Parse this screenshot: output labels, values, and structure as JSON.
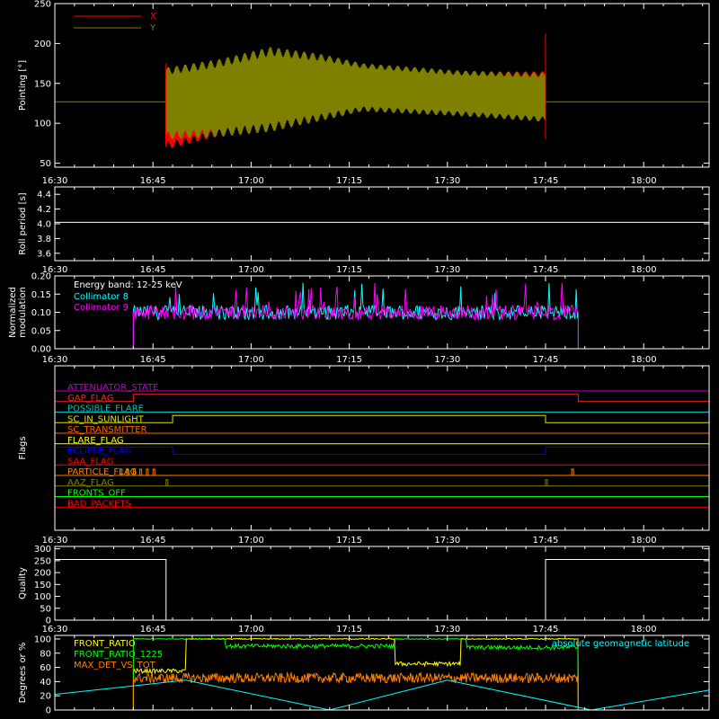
{
  "time_axis": {
    "range": [
      "16:30",
      "18:10"
    ],
    "ticks": [
      "16:30",
      "16:45",
      "17:00",
      "17:15",
      "17:30",
      "17:45",
      "18:00"
    ]
  },
  "chart_data": [
    {
      "id": "pointing",
      "type": "line",
      "title": "",
      "xlabel": "",
      "ylabel": "Pointing [°]",
      "ylim": [
        45,
        250
      ],
      "yticks": [
        50,
        100,
        150,
        200,
        250
      ],
      "legend": {
        "placement": "top-left",
        "entries": [
          {
            "name": "X",
            "color": "#ff0000"
          },
          {
            "name": "Y",
            "color": "#808000"
          }
        ]
      },
      "reference_line": {
        "y": 127,
        "color": "#808000"
      },
      "series": [
        {
          "name": "X",
          "color": "#ff0000",
          "start": "16:47",
          "end": "17:45",
          "upper": [
            [
              0,
              155
            ],
            [
              15,
              168
            ],
            [
              30,
              158
            ],
            [
              45,
              162
            ],
            [
              58,
              162
            ]
          ],
          "lower": [
            [
              0,
              72
            ],
            [
              15,
              102
            ],
            [
              30,
              122
            ],
            [
              45,
              118
            ],
            [
              58,
              110
            ]
          ]
        },
        {
          "name": "Y",
          "color": "#808000",
          "start": "16:47",
          "end": "17:45",
          "upper": [
            [
              0,
              165
            ],
            [
              8,
              175
            ],
            [
              16,
              190
            ],
            [
              24,
              182
            ],
            [
              30,
              172
            ],
            [
              45,
              163
            ],
            [
              58,
              160
            ]
          ],
          "lower": [
            [
              0,
              85
            ],
            [
              8,
              88
            ],
            [
              16,
              95
            ],
            [
              24,
              108
            ],
            [
              30,
              118
            ],
            [
              45,
              112
            ],
            [
              58,
              105
            ]
          ]
        }
      ],
      "spikes": [
        {
          "x": "16:47",
          "y": [
            70,
            175
          ]
        },
        {
          "x": "17:45",
          "y": [
            80,
            212
          ]
        }
      ]
    },
    {
      "id": "roll-period",
      "type": "line",
      "title": "",
      "ylabel": "Roll period [s]",
      "ylim": [
        3.5,
        4.5
      ],
      "yticks": [
        "3.6",
        "3.8",
        "4.0",
        "4.2",
        "4.4"
      ],
      "series": [
        {
          "name": "",
          "color": "#ffffff",
          "x": [
            "16:30",
            "18:10"
          ],
          "values": [
            4.02,
            4.02
          ]
        }
      ]
    },
    {
      "id": "modulation",
      "type": "line",
      "title": "",
      "ylabel": "Normalized modulation",
      "ylim": [
        0,
        0.2
      ],
      "yticks": [
        "0.00",
        "0.05",
        "0.10",
        "0.15",
        "0.20"
      ],
      "annotation": "Energy band: 12-25 keV",
      "legend": {
        "placement": "top-left",
        "entries": [
          {
            "name": "Collimator 8",
            "color": "#00ffff"
          },
          {
            "name": "Collimator 9",
            "color": "#ff00ff"
          }
        ]
      },
      "active_range": [
        "16:42",
        "17:50"
      ],
      "series": [
        {
          "name": "Collimator 8",
          "color": "#00ffff",
          "baseline": 0.1
        },
        {
          "name": "Collimator 9",
          "color": "#ff00ff",
          "baseline": 0.1
        }
      ]
    },
    {
      "id": "flags",
      "type": "line",
      "title": "",
      "ylabel": "Flags",
      "flags": [
        {
          "name": "ATTENUATOR_STATE",
          "color": "#c000c0",
          "steps": []
        },
        {
          "name": "GAP_FLAG",
          "color": "#ff2020",
          "steps": [
            [
              "16:30",
              0
            ],
            [
              "16:42",
              1
            ],
            [
              "17:50",
              0
            ]
          ]
        },
        {
          "name": "POSSIBLE_FLARE",
          "color": "#00c0c0",
          "steps": []
        },
        {
          "name": "SC_IN_SUNLIGHT",
          "color": "#e0e000",
          "steps": [
            [
              "16:30",
              0
            ],
            [
              "16:48",
              1
            ],
            [
              "17:45",
              0
            ]
          ]
        },
        {
          "name": "SC_TRANSMITTER",
          "color": "#ff6000",
          "steps": []
        },
        {
          "name": "FLARE_FLAG",
          "color": "#ffff00",
          "steps": []
        },
        {
          "name": "ECLIPSE_FLAG",
          "color": "#0000ff",
          "steps": [
            [
              "16:30",
              1
            ],
            [
              "16:48",
              0
            ],
            [
              "17:45",
              1
            ]
          ]
        },
        {
          "name": "SAA_FLAG",
          "color": "#ff0000",
          "steps": []
        },
        {
          "name": "PARTICLE_FLAG",
          "color": "#ff7f00",
          "pulses": [
            "16:40",
            "16:41",
            "16:42",
            "16:43",
            "16:44",
            "16:45",
            "17:49"
          ]
        },
        {
          "name": "AAZ_FLAG",
          "color": "#808000",
          "pulses": [
            "16:47",
            "17:45"
          ]
        },
        {
          "name": "FRONTS_OFF",
          "color": "#00ff00",
          "steps": []
        },
        {
          "name": "BAD_PACKETS",
          "color": "#ff0000",
          "steps": []
        }
      ]
    },
    {
      "id": "quality",
      "type": "line",
      "title": "",
      "ylabel": "Quality",
      "ylim": [
        0,
        310
      ],
      "yticks": [
        0,
        50,
        100,
        150,
        200,
        250,
        300
      ],
      "series": [
        {
          "name": "",
          "color": "#ffffff",
          "x": [
            "16:30",
            "16:47",
            "16:47",
            "17:45",
            "17:45",
            "18:10"
          ],
          "values": [
            255,
            255,
            0,
            0,
            255,
            255
          ]
        }
      ]
    },
    {
      "id": "ratios",
      "type": "line",
      "title": "",
      "ylabel": "Degrees or %",
      "ylim": [
        0,
        105
      ],
      "yticks": [
        0,
        20,
        40,
        60,
        80,
        100
      ],
      "legend": {
        "placement": "top-left",
        "entries": [
          {
            "name": "FRONT_RATIO",
            "color": "#ffff00"
          },
          {
            "name": "FRONT_RATIO_1225",
            "color": "#00ff00"
          },
          {
            "name": "MAX_DET_VS_TOT",
            "color": "#ff8000"
          }
        ]
      },
      "annotation": "absolute geomagnetic latitude",
      "annotation_color": "#00ffff",
      "series": [
        {
          "name": "FRONT_RATIO",
          "color": "#ffff00",
          "start": "16:42",
          "end": "17:50",
          "segments": [
            [
              "16:42",
              "16:50",
              55
            ],
            [
              "16:50",
              "17:22",
              100
            ],
            [
              "17:22",
              "17:32",
              65
            ],
            [
              "17:32",
              "17:50",
              100
            ]
          ]
        },
        {
          "name": "FRONT_RATIO_1225",
          "color": "#00ff00",
          "start": "16:42",
          "end": "17:50",
          "segments": [
            [
              "16:42",
              "16:56",
              100
            ],
            [
              "16:56",
              "17:22",
              90
            ],
            [
              "17:22",
              "17:33",
              100
            ],
            [
              "17:33",
              "17:50",
              88
            ]
          ]
        },
        {
          "name": "MAX_DET_VS_TOT",
          "color": "#ff8000",
          "start": "16:42",
          "end": "17:50",
          "baseline": 45
        },
        {
          "name": "absolute geomagnetic latitude",
          "color": "#00ffff",
          "x": [
            "16:30",
            "16:50",
            "17:12",
            "17:30",
            "17:52",
            "18:10"
          ],
          "values": [
            22,
            42,
            0,
            42,
            0,
            28
          ]
        }
      ]
    }
  ]
}
